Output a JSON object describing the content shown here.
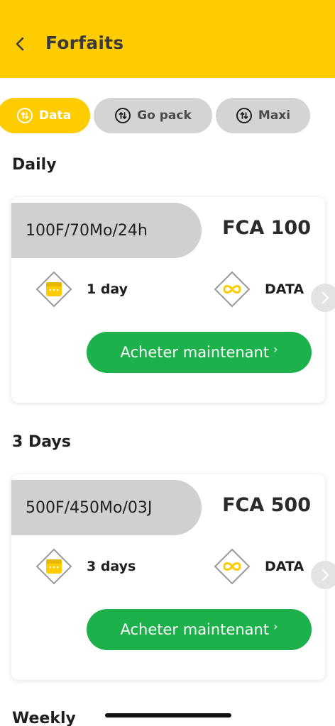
{
  "header": {
    "title": "Forfaits",
    "background": "#FFCC00",
    "back_icon": "chevron-left-icon"
  },
  "tabs": [
    {
      "label": "Data",
      "active": true,
      "icon": "data-transfer-icon"
    },
    {
      "label": "Go pack",
      "active": false,
      "icon": "data-transfer-icon"
    },
    {
      "label": "Maxi",
      "active": false,
      "icon": "data-transfer-icon"
    }
  ],
  "sections": [
    {
      "title": "Daily",
      "card": {
        "plan": "100F/70Mo/24h",
        "price": "FCA 100",
        "duration": "1 day",
        "type": "DATA",
        "button": "Acheter maintenant"
      }
    },
    {
      "title": "3 Days",
      "card": {
        "plan": "500F/450Mo/03J",
        "price": "FCA 500",
        "duration": "3 days",
        "type": "DATA",
        "button": "Acheter maintenant"
      }
    },
    {
      "title": "Weekly"
    }
  ],
  "colors": {
    "accent": "#FFCC00",
    "button_green": "#1DB14B",
    "inactive_tab": "#D4D4D4"
  }
}
